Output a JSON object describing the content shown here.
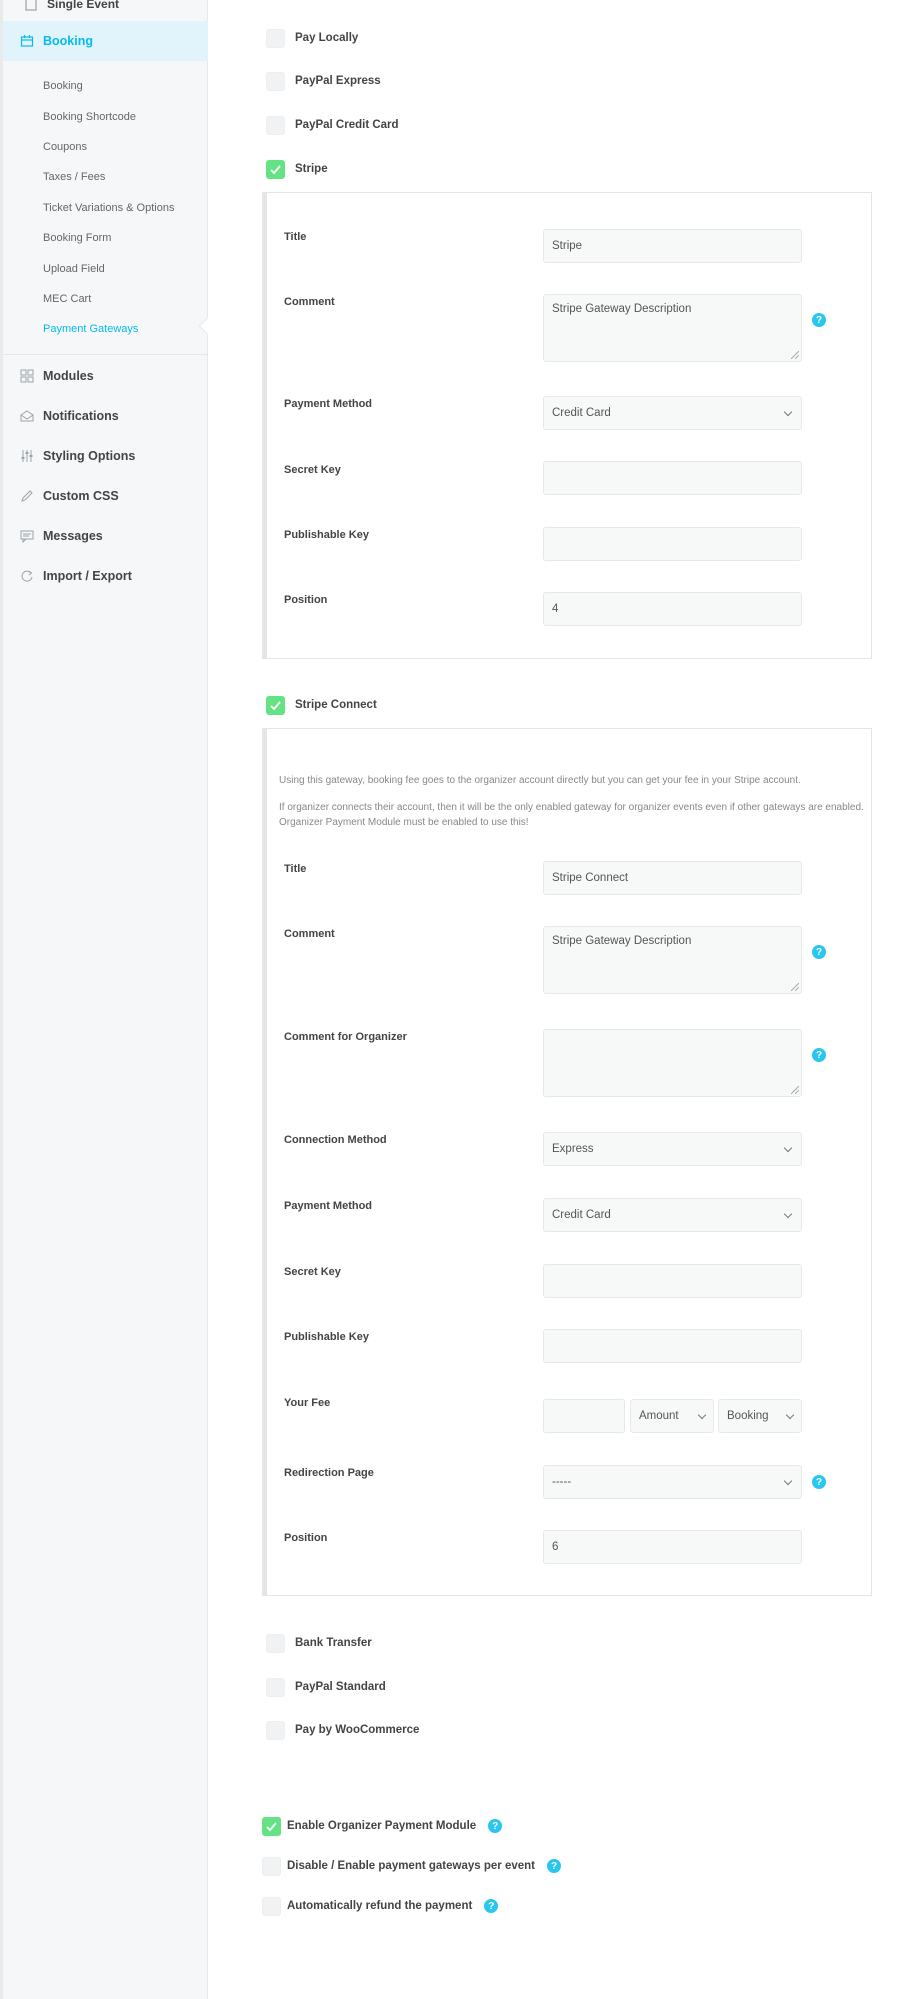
{
  "sidebar": {
    "top_item": "Single Event",
    "active_section": "Booking",
    "submenu": [
      "Booking",
      "Booking Shortcode",
      "Coupons",
      "Taxes / Fees",
      "Ticket Variations & Options",
      "Booking Form",
      "Upload Field",
      "MEC Cart",
      "Payment Gateways"
    ],
    "current_submenu": "Payment Gateways",
    "menu": [
      {
        "label": "Modules",
        "icon": "grid-icon"
      },
      {
        "label": "Notifications",
        "icon": "envelope-icon"
      },
      {
        "label": "Styling Options",
        "icon": "sliders-icon"
      },
      {
        "label": "Custom CSS",
        "icon": "pencil-icon"
      },
      {
        "label": "Messages",
        "icon": "message-icon"
      },
      {
        "label": "Import / Export",
        "icon": "sync-icon"
      }
    ]
  },
  "gateways_top": [
    {
      "label": "Pay Locally",
      "checked": false
    },
    {
      "label": "PayPal Express",
      "checked": false
    },
    {
      "label": "PayPal Credit Card",
      "checked": false
    },
    {
      "label": "Stripe",
      "checked": true
    }
  ],
  "stripe": {
    "title_label": "Title",
    "title_value": "Stripe",
    "comment_label": "Comment",
    "comment_value": "Stripe Gateway Description",
    "payment_method_label": "Payment Method",
    "payment_method_value": "Credit Card",
    "secret_key_label": "Secret Key",
    "secret_key_value": "",
    "publishable_key_label": "Publishable Key",
    "publishable_key_value": "",
    "position_label": "Position",
    "position_value": "4"
  },
  "stripe_connect": {
    "label": "Stripe Connect",
    "checked": true,
    "note1": "Using this gateway, booking fee goes to the organizer account directly but you can get your fee in your Stripe account.",
    "note2": "If organizer connects their account, then it will be the only enabled gateway for organizer events even if other gateways are enabled. Organizer Payment Module must be enabled to use this!",
    "title_label": "Title",
    "title_value": "Stripe Connect",
    "comment_label": "Comment",
    "comment_value": "Stripe Gateway Description",
    "comment_org_label": "Comment for Organizer",
    "comment_org_value": "",
    "connection_method_label": "Connection Method",
    "connection_method_value": "Express",
    "payment_method_label": "Payment Method",
    "payment_method_value": "Credit Card",
    "secret_key_label": "Secret Key",
    "secret_key_value": "",
    "publishable_key_label": "Publishable Key",
    "publishable_key_value": "",
    "fee_label": "Your Fee",
    "fee_value": "",
    "fee_type": "Amount",
    "fee_per": "Booking",
    "redirection_label": "Redirection Page",
    "redirection_value": "-----",
    "position_label": "Position",
    "position_value": "6"
  },
  "gateways_bottom": [
    {
      "label": "Bank Transfer",
      "checked": false
    },
    {
      "label": "PayPal Standard",
      "checked": false
    },
    {
      "label": "Pay by WooCommerce",
      "checked": false
    }
  ],
  "options": [
    {
      "label": "Enable Organizer Payment Module",
      "checked": true
    },
    {
      "label": "Disable / Enable payment gateways per event",
      "checked": false
    },
    {
      "label": "Automatically refund the payment",
      "checked": false
    }
  ],
  "help_glyph": "?",
  "colors": {
    "accent": "#07bbe9",
    "check": "#64e385",
    "help": "#29c6ee"
  }
}
